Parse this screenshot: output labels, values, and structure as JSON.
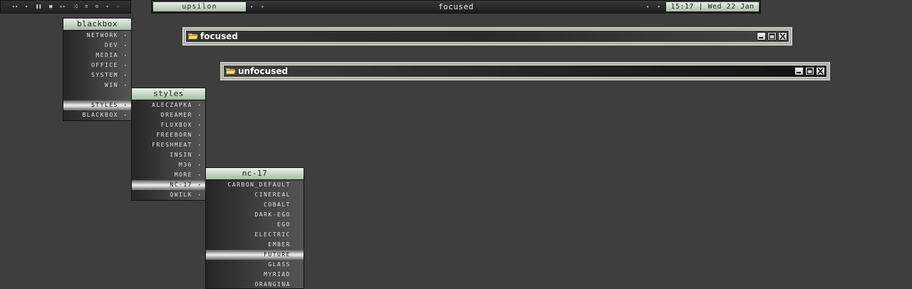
{
  "media_bar": {
    "buttons": [
      {
        "name": "rewind-icon",
        "glyph": "◂◂"
      },
      {
        "name": "play-icon",
        "glyph": "▸"
      },
      {
        "name": "pause-icon",
        "glyph": "❚❚"
      },
      {
        "name": "stop-icon",
        "glyph": "■"
      },
      {
        "name": "fast-forward-icon",
        "glyph": "▸▸"
      },
      {
        "name": "shuffle-icon",
        "glyph": "⤨"
      },
      {
        "name": "playlist-icon",
        "glyph": "≡"
      },
      {
        "name": "settings-icon",
        "glyph": "⚙"
      },
      {
        "name": "volume-up-icon",
        "glyph": "✦"
      },
      {
        "name": "volume-down-icon",
        "glyph": "✧"
      }
    ]
  },
  "toolbar": {
    "workspace": "upsilon",
    "window_title": "focused",
    "clock": "15:17 | Wed 22 Jan",
    "arrow_left": "◂",
    "arrow_right": "▸"
  },
  "menus": {
    "root": {
      "title": "blackbox",
      "items": [
        {
          "label": "NETWORK",
          "submenu": true
        },
        {
          "label": "DEV",
          "submenu": true
        },
        {
          "label": "MEDIA",
          "submenu": true
        },
        {
          "label": "OFFICE",
          "submenu": true
        },
        {
          "label": "SYSTEM",
          "submenu": true
        },
        {
          "label": "WIN",
          "submenu": true
        },
        {
          "label": "",
          "separator": true
        },
        {
          "label": "STYLES",
          "submenu": true,
          "selected": true
        },
        {
          "label": "BLACKBOX",
          "submenu": true
        }
      ]
    },
    "styles": {
      "title": "styles",
      "items": [
        {
          "label": "ALECZAPKA",
          "submenu": true
        },
        {
          "label": "DREAMER",
          "submenu": true
        },
        {
          "label": "FLUXBOX",
          "submenu": true
        },
        {
          "label": "FREEBORN",
          "submenu": true
        },
        {
          "label": "FRESHMEAT",
          "submenu": true
        },
        {
          "label": "INSIN",
          "submenu": true
        },
        {
          "label": "M36",
          "submenu": true
        },
        {
          "label": "MORE",
          "submenu": true
        },
        {
          "label": "NC-17",
          "submenu": true,
          "selected": true
        },
        {
          "label": "QWILK",
          "submenu": true
        }
      ]
    },
    "nc17": {
      "title": "nc-17",
      "items": [
        {
          "label": "CARBON_DEFAULT"
        },
        {
          "label": "CINEREAL"
        },
        {
          "label": "COBALT"
        },
        {
          "label": "DARK-EGO"
        },
        {
          "label": "EGO"
        },
        {
          "label": "ELECTRIC"
        },
        {
          "label": "EMBER"
        },
        {
          "label": "FUTURE",
          "selected": true
        },
        {
          "label": "GLASS"
        },
        {
          "label": "MYRIAD"
        },
        {
          "label": "ORANGINA"
        }
      ]
    },
    "submenu_arrow": "▸"
  },
  "windows": {
    "focused": {
      "title": "focused"
    },
    "unfocused": {
      "title": "unfocused"
    }
  },
  "colors": {
    "desktop": "#3e3e3e",
    "title_gradient_top": "#e9f2e9",
    "title_gradient_bottom": "#a9baa9",
    "selected_highlight": "#f2f2f2"
  }
}
